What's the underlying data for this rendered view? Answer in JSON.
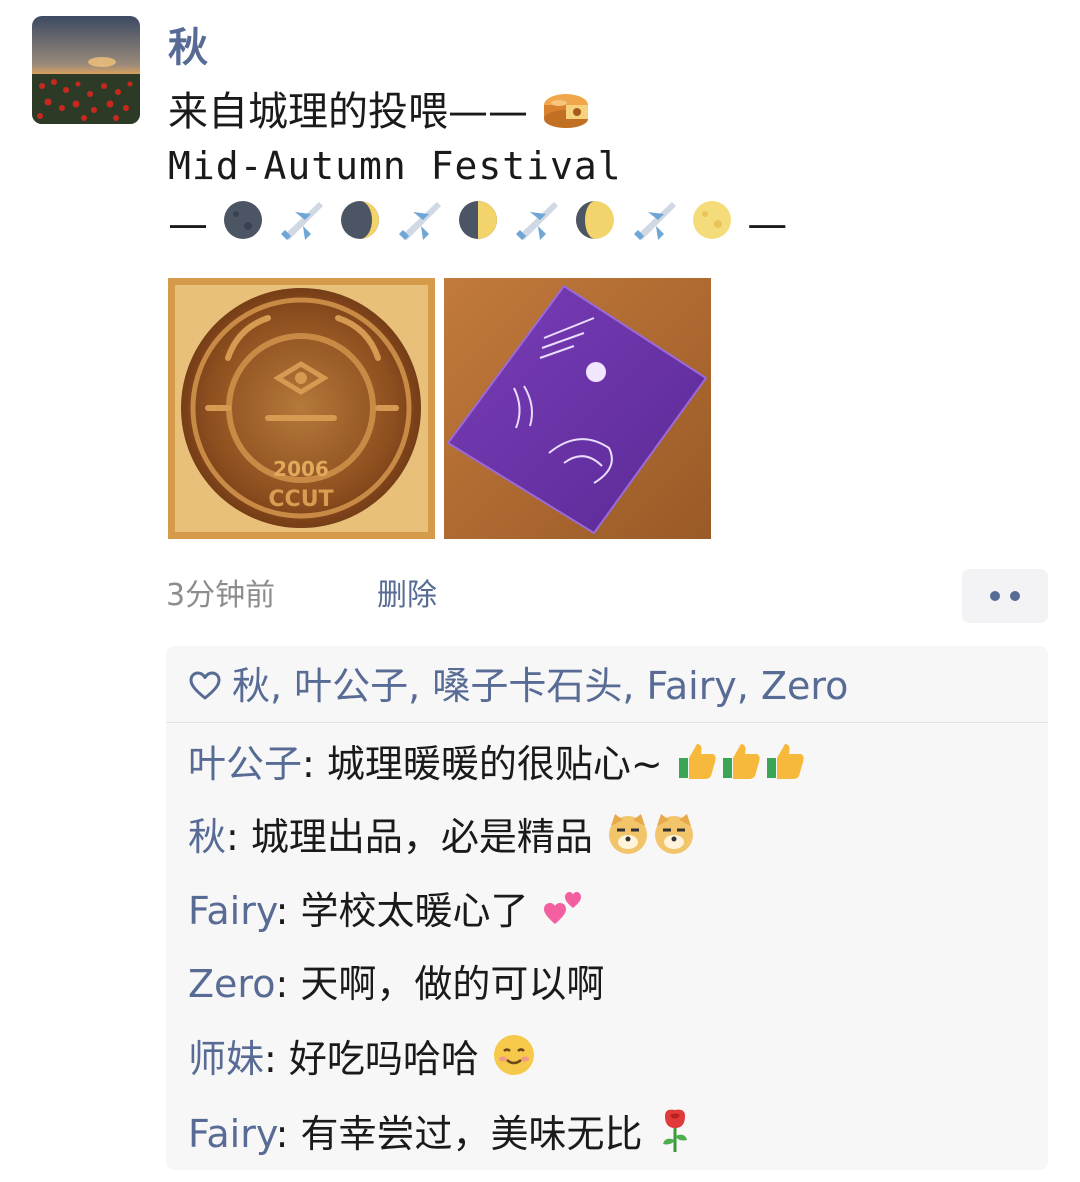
{
  "post": {
    "author": "秋",
    "line1": "来自城理的投喂——",
    "line2": "Mid-Autumn Festival",
    "line3_start": "—",
    "line3_end": "—",
    "time": "3分钟前",
    "delete_label": "删除"
  },
  "likes": {
    "names": "秋, 叶公子, 嗓子卡石头, Fairy, Zero"
  },
  "comments": [
    {
      "author": "叶公子",
      "sep": ": ",
      "text": "城理暖暖的很贴心~"
    },
    {
      "author": "秋",
      "sep": ": ",
      "text": "城理出品，必是精品"
    },
    {
      "author": "Fairy",
      "sep": ": ",
      "text": "学校太暖心了"
    },
    {
      "author": "Zero",
      "sep": ": ",
      "text": "天啊，做的可以啊"
    },
    {
      "author": "师妹",
      "sep": ": ",
      "text": "好吃吗哈哈"
    },
    {
      "author": "Fairy",
      "sep": ": ",
      "text": "有幸尝过，美味无比"
    }
  ],
  "photos": [
    {
      "name": "mooncake-photo",
      "embossed_text": [
        "2006",
        "CCUT"
      ]
    },
    {
      "name": "gift-box-photo"
    }
  ],
  "colors": {
    "link": "#576b95",
    "muted": "#8d8d8d",
    "panel": "#f7f7f7"
  }
}
